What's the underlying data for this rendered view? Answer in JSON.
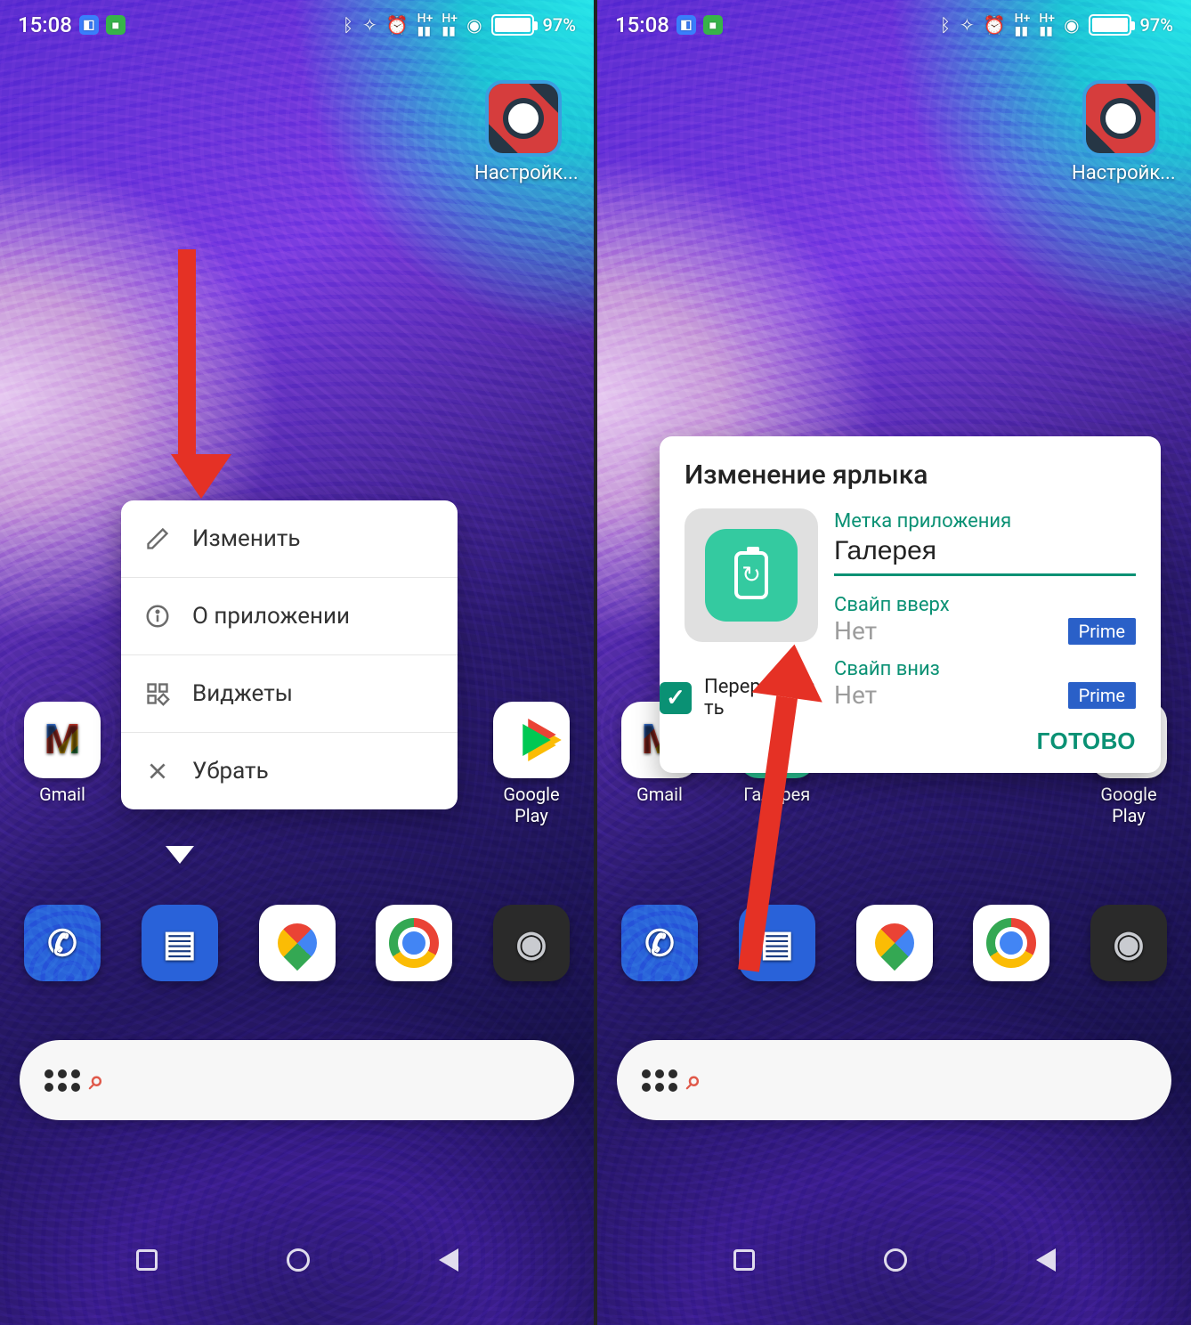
{
  "status": {
    "time": "15:08",
    "battery_pct": "97%"
  },
  "settings_app_label": "Настройк...",
  "apps": {
    "gmail": "Gmail",
    "gallery": "Галерея",
    "play": "Google Play"
  },
  "popup": {
    "edit": "Изменить",
    "about": "О приложении",
    "widgets": "Виджеты",
    "remove": "Убрать"
  },
  "dialog": {
    "title": "Изменение ярлыка",
    "label_caption": "Метка приложения",
    "label_value": "Галерея",
    "redraw_label": "Перерисовать",
    "swipe_up_caption": "Свайп вверх",
    "swipe_up_value": "Нет",
    "swipe_down_caption": "Свайп вниз",
    "swipe_down_value": "Нет",
    "prime": "Prime",
    "done": "ГОТОВО"
  }
}
